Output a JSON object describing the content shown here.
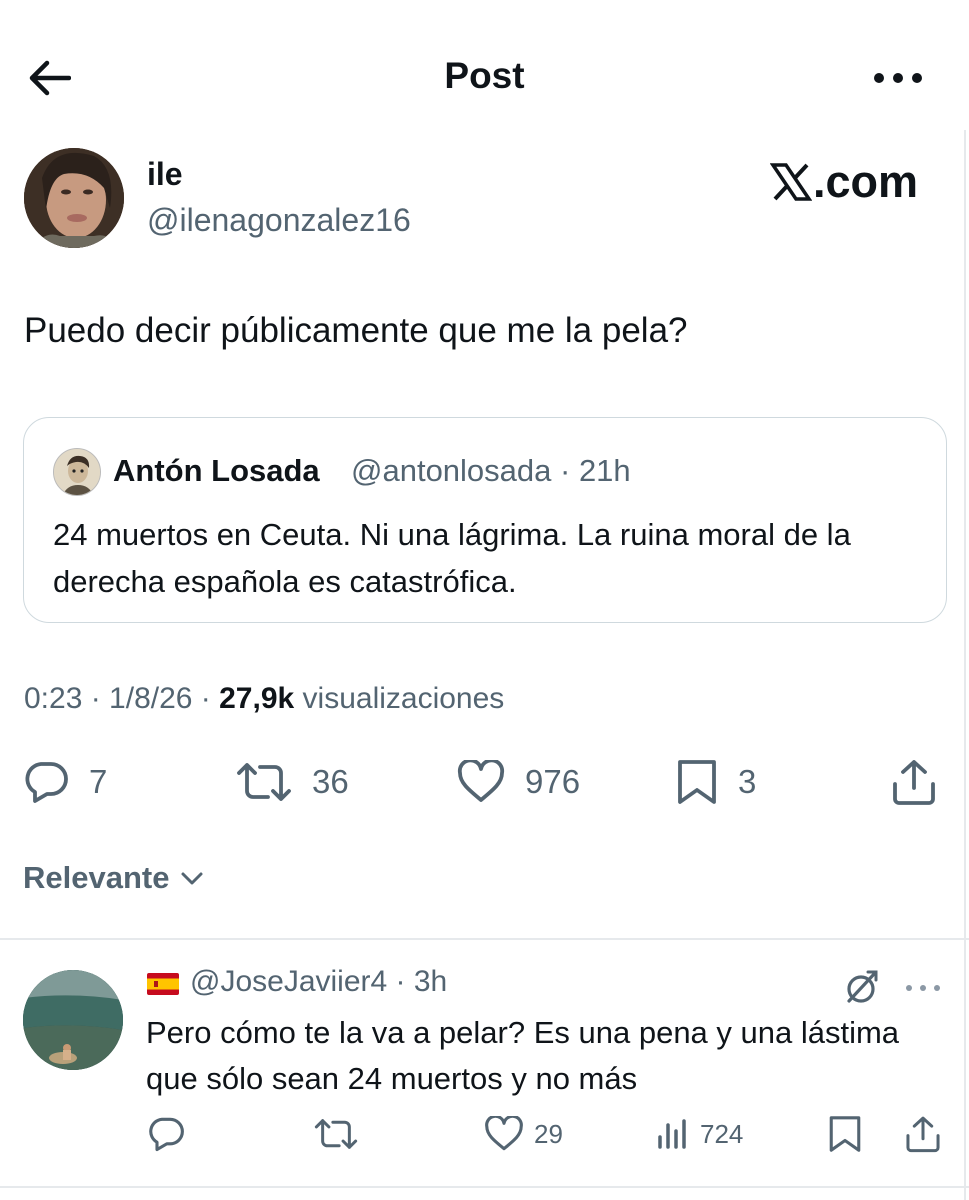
{
  "header": {
    "title": "Post"
  },
  "post": {
    "author_name": "ile",
    "author_handle": "@ilenagonzalez16",
    "watermark": ".com",
    "text": "Puedo decir públicamente que me la pela?",
    "quoted": {
      "name": "Antón Losada",
      "handle_time": "@antonlosada · 21h",
      "text": "24 muertos en Ceuta. Ni una lágrima. La ruina moral de la derecha española es catastrófica."
    },
    "meta": {
      "time_date": "0:23 · 1/8/26 · ",
      "views_count": "27,9k",
      "views_label": " visualizaciones"
    },
    "stats": {
      "replies": "7",
      "reposts": "36",
      "likes": "976",
      "bookmarks": "3"
    }
  },
  "sort": {
    "label": "Relevante"
  },
  "reply": {
    "handle_time": "@JoseJaviier4 · 3h",
    "text": "Pero cómo te la va a pelar? Es una pena y una lástima que sólo sean 24 muertos y no más",
    "stats": {
      "likes": "29",
      "views": "724"
    }
  },
  "colors": {
    "text_primary": "#0f1419",
    "text_secondary": "#536471",
    "border": "#cfd9de",
    "divider": "#e6e9ec"
  },
  "icons": [
    "back-arrow-icon",
    "more-icon",
    "reply-icon",
    "repost-icon",
    "like-icon",
    "bookmark-icon",
    "share-icon",
    "chevron-down-icon",
    "grok-icon",
    "views-icon",
    "spain-flag-icon",
    "x-logo-icon"
  ]
}
